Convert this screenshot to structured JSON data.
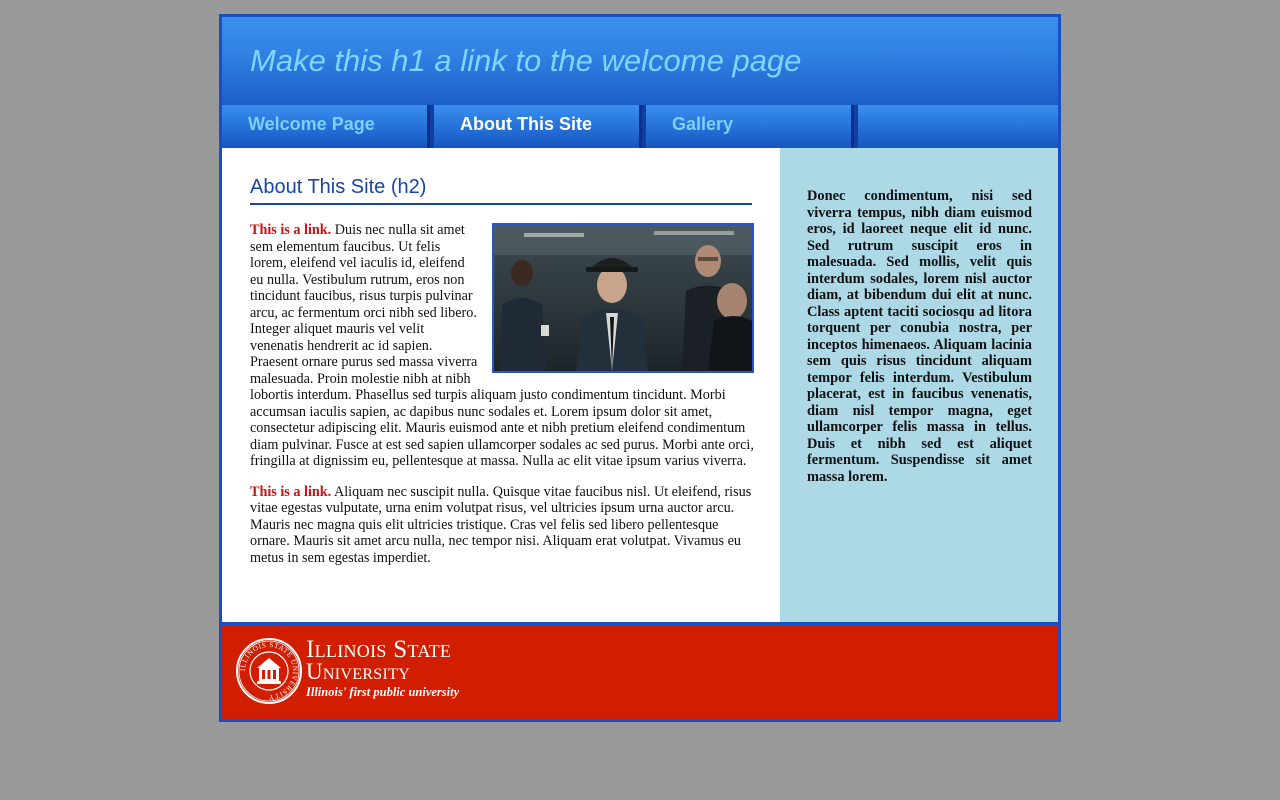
{
  "header": {
    "title": "Make this h1 a link to the welcome page"
  },
  "nav": {
    "items": [
      {
        "label": "Welcome Page",
        "current": false
      },
      {
        "label": "About This Site",
        "current": true
      },
      {
        "label": "Gallery",
        "current": false
      },
      {
        "label": "",
        "current": false
      }
    ]
  },
  "content": {
    "title": "About This Site (h2)",
    "paragraphs": [
      {
        "link": "This is a link.",
        "text": " Duis nec nulla sit amet sem elementum faucibus. Ut felis lorem, eleifend vel iaculis id, eleifend eu nulla. Vestibulum rutrum, eros non tincidunt faucibus, risus turpis pulvinar arcu, ac fermentum orci nibh sed libero. Integer aliquet mauris vel velit venenatis hendrerit ac id sapien. Praesent ornare purus sed massa viverra malesuada. Proin molestie nibh at nibh lobortis interdum. Phasellus sed turpis aliquam justo condimentum tincidunt. Morbi accumsan iaculis sapien, ac dapibus nunc sodales et. Lorem ipsum dolor sit amet, consectetur adipiscing elit. Mauris euismod ante et nibh pretium eleifend condimentum diam pulvinar. Fusce at est sed sapien ullamcorper sodales ac sed purus. Morbi ante orci, fringilla at dignissim eu, pellentesque at massa. Nulla ac elit vitae ipsum varius viverra."
      },
      {
        "link": "This is a link.",
        "text": " Aliquam nec suscipit nulla. Quisque vitae faucibus nisl. Ut eleifend, risus vitae egestas vulputate, urna enim volutpat risus, vel ultricies ipsum urna auctor arcu. Mauris nec magna quis elit ultricies tristique. Cras vel felis sed libero pellentesque ornare. Mauris sit amet arcu nulla, nec tempor nisi. Aliquam erat volutpat. Vivamus eu metus in sem egestas imperdiet."
      }
    ]
  },
  "sidebar": {
    "text": "Donec condimentum, nisi sed viverra tempus, nibh diam euismod eros, id laoreet neque elit id nunc. Sed rutrum suscipit eros in malesuada. Sed mollis, velit quis interdum sodales, lorem nisl auctor diam, at bibendum dui elit at nunc. Class aptent taciti sociosqu ad litora torquent per conubia nostra, per inceptos himenaeos. Aliquam lacinia sem quis risus tincidunt aliquam tempor felis interdum. Vestibulum placerat, est in faucibus venenatis, diam nisl tempor magna, eget ullamcorper felis massa in tellus. Duis et nibh sed est aliquet fermentum. Suspendisse sit amet massa lorem."
  },
  "footer": {
    "name_line1": "Illinois State",
    "name_line2": "University",
    "tagline": "Illinois' first public university",
    "seal_text": "ILLINOIS STATE UNIVERSITY"
  },
  "colors": {
    "page_background": "#999999",
    "header_blue": "#2f80e2",
    "title_cyan": "#7dd6ff",
    "link_red": "#cc1111",
    "sidebar_bg": "#add8e6",
    "footer_red": "#d21e00"
  }
}
